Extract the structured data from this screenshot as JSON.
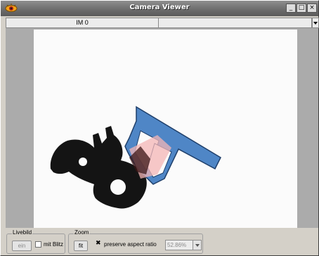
{
  "window": {
    "title": "Camera Viewer",
    "app_icon": "eye-icon",
    "controls": {
      "minimize": "_",
      "maximize": "□",
      "close": "×"
    }
  },
  "tabs": [
    {
      "label": "IM 0",
      "selected": true
    },
    {
      "label": ""
    }
  ],
  "livebild": {
    "group_label": "Livebild",
    "button_label": "ein",
    "checkbox_label": "mit Blitz",
    "checkbox_checked": false
  },
  "zoom": {
    "group_label": "Zoom",
    "fit_label": "fit",
    "aspect_label": "preserve aspect ratio",
    "aspect_checked": true,
    "value": "52.86%"
  },
  "colors": {
    "part_fill": "#141414",
    "gripper_fill": "#4f86c6",
    "gripper_stroke": "#1f3f6a",
    "overlay_fill": "#f4b6b6"
  }
}
